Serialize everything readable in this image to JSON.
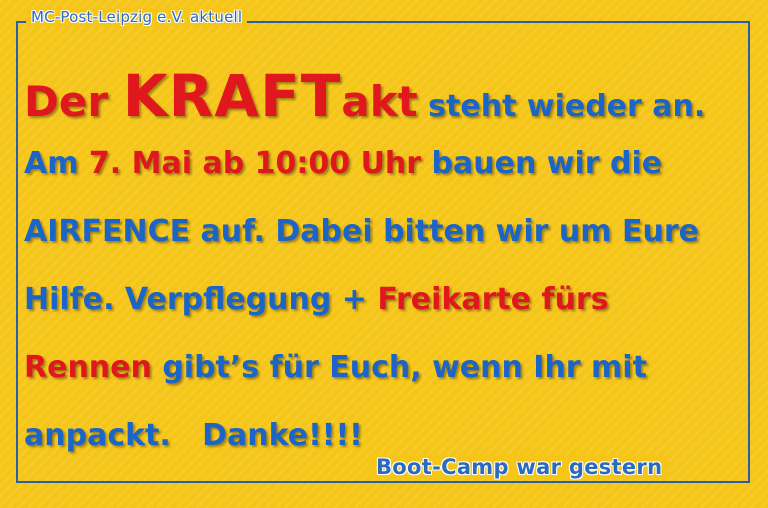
{
  "header_label": "MC-Post-Leipzig e.V. aktuell",
  "footer_label": "Boot-Camp war gestern",
  "lines": [
    [
      {
        "text": "Der ",
        "color": "red",
        "size": "big"
      },
      {
        "text": "KRAFT",
        "color": "red",
        "size": "huge"
      },
      {
        "text": "akt",
        "color": "red",
        "size": "big"
      },
      {
        "text": " steht wieder an.",
        "color": "blue",
        "size": "normal"
      }
    ],
    [
      {
        "text": "Am ",
        "color": "blue",
        "size": "normal"
      },
      {
        "text": "7. Mai ab 10:00 Uhr",
        "color": "red",
        "size": "normal"
      },
      {
        "text": " bauen wir die",
        "color": "blue",
        "size": "normal"
      }
    ],
    [
      {
        "text": "AIRFENCE auf. Dabei bitten wir um Eure",
        "color": "blue",
        "size": "normal"
      }
    ],
    [
      {
        "text": "Hilfe. Verpflegung + ",
        "color": "blue",
        "size": "normal"
      },
      {
        "text": "Freikarte fürs",
        "color": "red",
        "size": "normal"
      }
    ],
    [
      {
        "text": "Rennen",
        "color": "red",
        "size": "normal"
      },
      {
        "text": " gibt’s für Euch, wenn Ihr mit",
        "color": "blue",
        "size": "normal"
      }
    ],
    [
      {
        "text": "anpackt.   Danke!!!!",
        "color": "blue",
        "size": "normal"
      }
    ]
  ],
  "colors": {
    "background": "#f5c518",
    "blue_text": "#1b64c8",
    "red_text": "#e0181e",
    "frame": "#2a5fa8"
  }
}
